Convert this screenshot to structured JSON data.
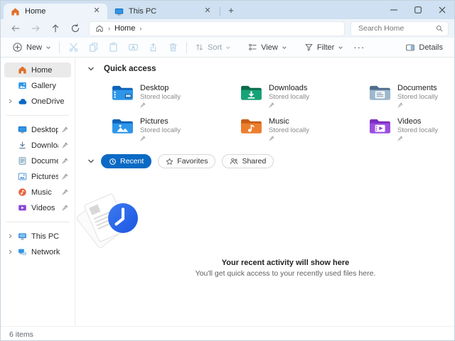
{
  "colors": {
    "accent": "#0b6ac4",
    "tabbar_bg": "#cee0f1",
    "active_tab_bg": "#eef4fa",
    "sidebar_selected_bg": "#eaeaea"
  },
  "tabs": [
    {
      "label": "Home",
      "active": true
    },
    {
      "label": "This PC",
      "active": false
    }
  ],
  "navigation": {
    "breadcrumb": {
      "path": [
        "Home"
      ]
    },
    "search": {
      "placeholder": "Search Home"
    }
  },
  "toolbar": {
    "new": "New",
    "sort": "Sort",
    "view": "View",
    "filter": "Filter",
    "more": "···",
    "details": "Details"
  },
  "sidebar": {
    "items": [
      {
        "label": "Home",
        "selected": true
      },
      {
        "label": "Gallery"
      },
      {
        "label": "OneDrive",
        "expandable": true
      },
      {
        "label": "Desktop",
        "pinned": true
      },
      {
        "label": "Downloads",
        "pinned": true
      },
      {
        "label": "Documents",
        "pinned": true
      },
      {
        "label": "Pictures",
        "pinned": true
      },
      {
        "label": "Music",
        "pinned": true
      },
      {
        "label": "Videos",
        "pinned": true
      },
      {
        "label": "This PC",
        "expandable": true
      },
      {
        "label": "Network",
        "expandable": true
      }
    ]
  },
  "quick_access": {
    "title": "Quick access",
    "items": [
      {
        "name": "Desktop",
        "status": "Stored locally"
      },
      {
        "name": "Downloads",
        "status": "Stored locally"
      },
      {
        "name": "Documents",
        "status": "Stored locally"
      },
      {
        "name": "Pictures",
        "status": "Stored locally"
      },
      {
        "name": "Music",
        "status": "Stored locally"
      },
      {
        "name": "Videos",
        "status": "Stored locally"
      }
    ]
  },
  "activity_filters": [
    {
      "label": "Recent",
      "active": true
    },
    {
      "label": "Favorites",
      "active": false
    },
    {
      "label": "Shared",
      "active": false
    }
  ],
  "empty_state": {
    "title": "Your recent activity will show here",
    "subtitle": "You'll get quick access to your recently used files here."
  },
  "status_bar": {
    "item_count": "6 items"
  }
}
